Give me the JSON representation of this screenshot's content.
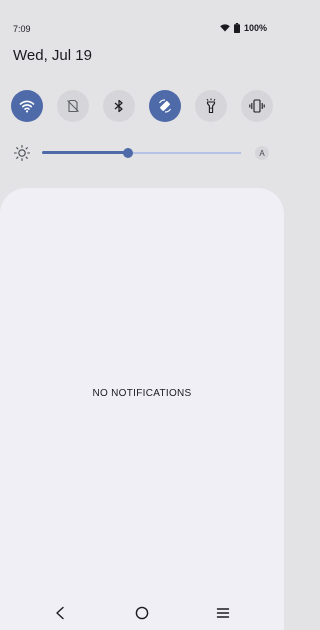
{
  "status": {
    "time": "7:09",
    "battery": "100%",
    "icons": [
      "wifi-signal-icon",
      "battery-icon"
    ]
  },
  "shade": {
    "date": "Wed, Jul 19",
    "quick_settings": [
      {
        "id": "wifi",
        "icon": "wifi-icon",
        "active": true
      },
      {
        "id": "mobile-data",
        "icon": "no-sim-icon",
        "active": false
      },
      {
        "id": "bluetooth",
        "icon": "bluetooth-icon",
        "active": false
      },
      {
        "id": "auto-rotate",
        "icon": "auto-rotate-icon",
        "active": true
      },
      {
        "id": "flashlight",
        "icon": "flashlight-icon",
        "active": false
      },
      {
        "id": "vibrate",
        "icon": "vibrate-icon",
        "active": false
      }
    ],
    "brightness": {
      "level": 0.43,
      "auto_label": "A",
      "icon": "brightness-icon"
    }
  },
  "notifications": {
    "empty_label": "NO NOTIFICATIONS"
  },
  "navigation": {
    "icons": [
      "back-icon",
      "home-icon",
      "recents-icon"
    ]
  },
  "colors": {
    "accent": "#4f6aa8",
    "tile_off": "#d6d6da",
    "background": "#e3e3e6",
    "panel": "#f0eff5"
  }
}
